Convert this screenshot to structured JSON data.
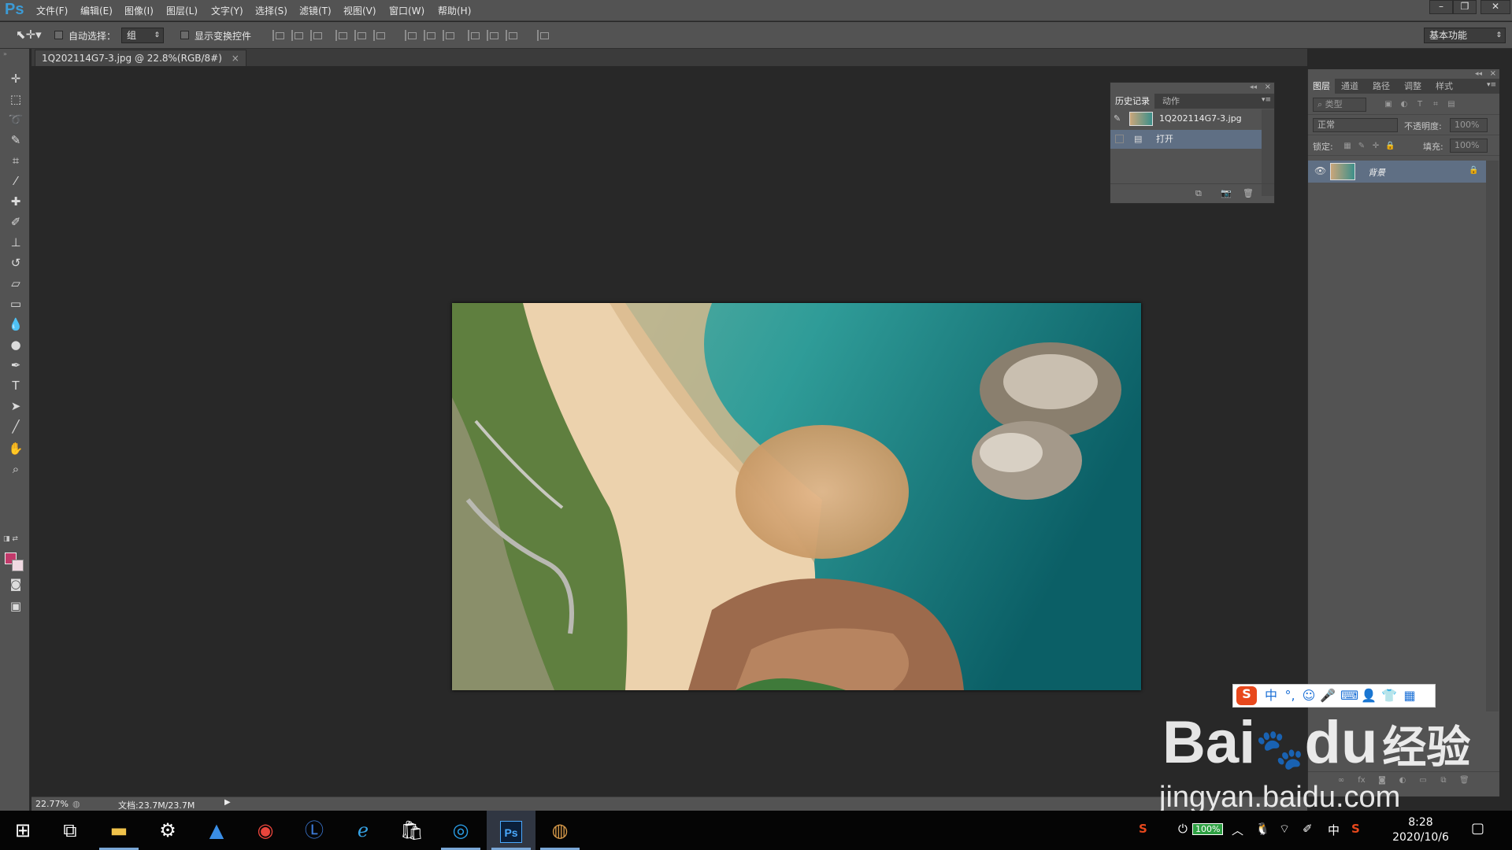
{
  "app": {
    "logo": "Ps",
    "workspace": "基本功能"
  },
  "menu": [
    "文件(F)",
    "编辑(E)",
    "图像(I)",
    "图层(L)",
    "文字(Y)",
    "选择(S)",
    "滤镜(T)",
    "视图(V)",
    "窗口(W)",
    "帮助(H)"
  ],
  "window_controls": [
    "–",
    "❐",
    "✕"
  ],
  "options": {
    "auto_select_label": "自动选择：",
    "auto_select_value": "组",
    "show_transform_label": "显示变换控件"
  },
  "document": {
    "tab_title": "1Q202114G7-3.jpg @ 22.8%(RGB/8#)",
    "tab_close": "×",
    "zoom": "22.77%",
    "doc_size": "文档:23.7M/23.7M"
  },
  "history_panel": {
    "tabs": [
      "历史记录",
      "动作"
    ],
    "snapshot": "1Q202114G7-3.jpg",
    "steps": [
      "打开"
    ]
  },
  "layers_panel": {
    "tabs": [
      "图层",
      "通道",
      "路径",
      "调整",
      "样式"
    ],
    "filter_type": "类型",
    "blend_mode": "正常",
    "opacity_label": "不透明度:",
    "opacity_value": "100%",
    "lock_label": "锁定:",
    "fill_label": "填充:",
    "fill_value": "100%",
    "layers": [
      {
        "name": "背景",
        "visible": true,
        "locked": true
      }
    ]
  },
  "ime": {
    "lang": "中"
  },
  "watermark": {
    "brand_left": "Bai",
    "brand_mid": "du",
    "brand_right": "经验",
    "url": "jingyan.baidu.com"
  },
  "taskbar": {
    "battery": "100%",
    "ime_lang": "中",
    "time": "8:28",
    "date": "2020/10/6"
  },
  "colors": {
    "foreground": "#c23a6b",
    "background": "#f0d9e2",
    "accent": "#3c9bd6"
  }
}
